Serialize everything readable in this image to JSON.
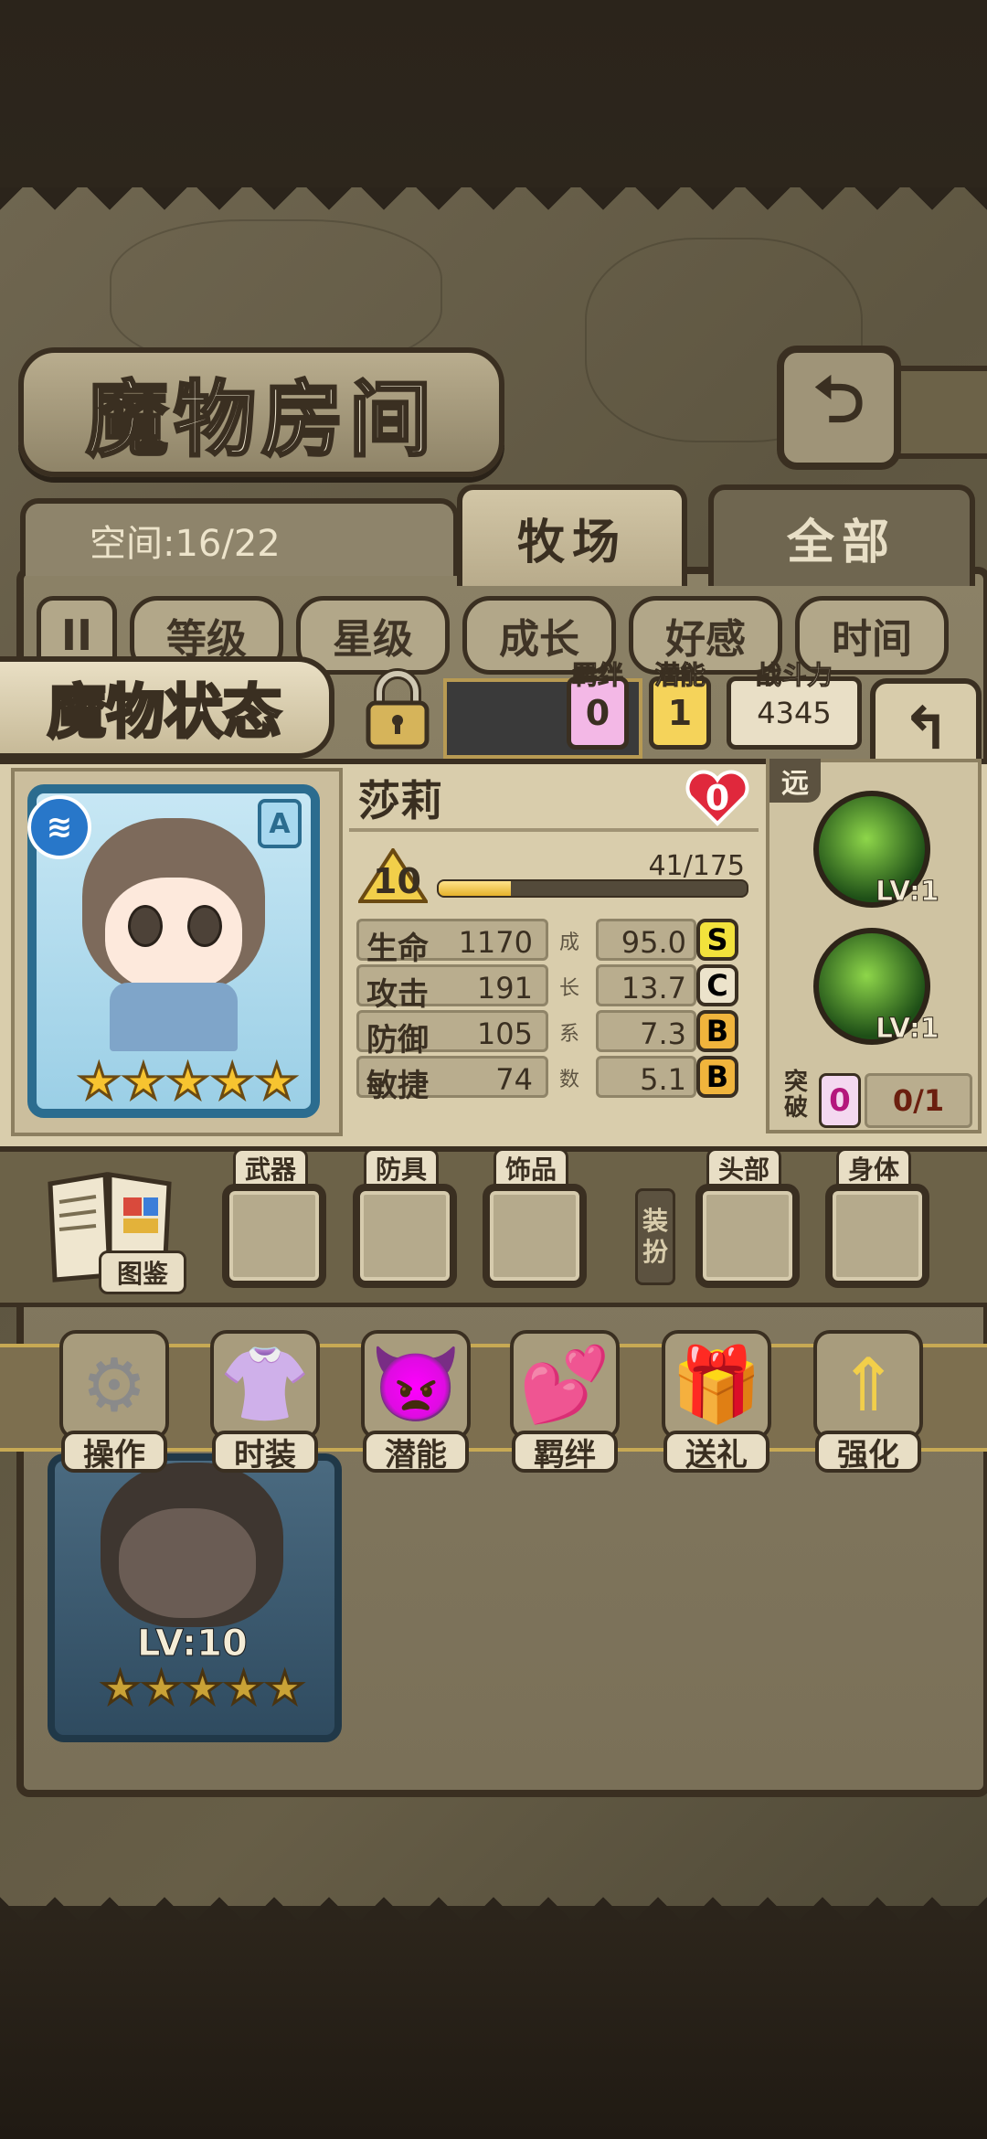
{
  "header": {
    "title": "魔物房间",
    "back_glyph": "⮌"
  },
  "space": {
    "text": "空间:16/22"
  },
  "tabs": [
    {
      "label": "牧场",
      "active": true
    },
    {
      "label": "全部",
      "active": false
    }
  ],
  "sort_bar": {
    "pause_glyph": "II",
    "buttons": [
      "等级",
      "星级",
      "成长",
      "好感",
      "时间"
    ]
  },
  "status": {
    "title": "魔物状态",
    "bond": {
      "label": "羁绊",
      "value": "0"
    },
    "potential": {
      "label": "潜能",
      "value": "1"
    },
    "power": {
      "label": "战斗力",
      "value": "4345"
    },
    "back_glyph": "↰"
  },
  "monster": {
    "name": "莎莉",
    "hearts": "0",
    "element_glyph": "≋",
    "rank": "A",
    "stars": 5,
    "level": "10",
    "exp_text": "41/175",
    "exp_fraction": 0.234,
    "growth_chars": [
      "成",
      "长",
      "系",
      "数"
    ],
    "stats": [
      {
        "name": "生命",
        "value": "1170",
        "growth": "95.0",
        "grade": "S"
      },
      {
        "name": "攻击",
        "value": "191",
        "growth": "13.7",
        "grade": "C"
      },
      {
        "name": "防御",
        "value": "105",
        "growth": "7.3",
        "grade": "B"
      },
      {
        "name": "敏捷",
        "value": "74",
        "growth": "5.1",
        "grade": "B"
      }
    ]
  },
  "skills": {
    "range": "远",
    "items": [
      {
        "lv": "LV:1",
        "icon": "wind-skill-icon"
      },
      {
        "lv": "LV:1",
        "icon": "drum-skill-icon"
      }
    ],
    "breakthrough": {
      "label": "突破",
      "value": "0",
      "progress": "0/1"
    }
  },
  "equipment": {
    "book_label": "图鉴",
    "slots": [
      "武器",
      "防具",
      "饰品",
      "头部",
      "身体"
    ],
    "dressup_label": [
      "装",
      "扮"
    ]
  },
  "actions": [
    {
      "label": "操作",
      "icon": "gear-icon",
      "glyph": "⚙"
    },
    {
      "label": "时装",
      "icon": "outfit-icon",
      "glyph": "👚"
    },
    {
      "label": "潜能",
      "icon": "shadow-icon",
      "glyph": "👿"
    },
    {
      "label": "羁绊",
      "icon": "hearts-icon",
      "glyph": "💕"
    },
    {
      "label": "送礼",
      "icon": "gift-icon",
      "glyph": "🎁"
    },
    {
      "label": "强化",
      "icon": "upgrade-arrows-icon",
      "glyph": "⇑"
    }
  ],
  "list": {
    "card_lv": "LV:10",
    "card_stars": 5
  },
  "colors": {
    "grade_S": "#f2e23c",
    "grade_C": "#ece3cb",
    "grade_B": "#f0b43c",
    "bond": "#f3b8e6",
    "potential": "#f5d35a",
    "power": "#e9dfc6"
  }
}
